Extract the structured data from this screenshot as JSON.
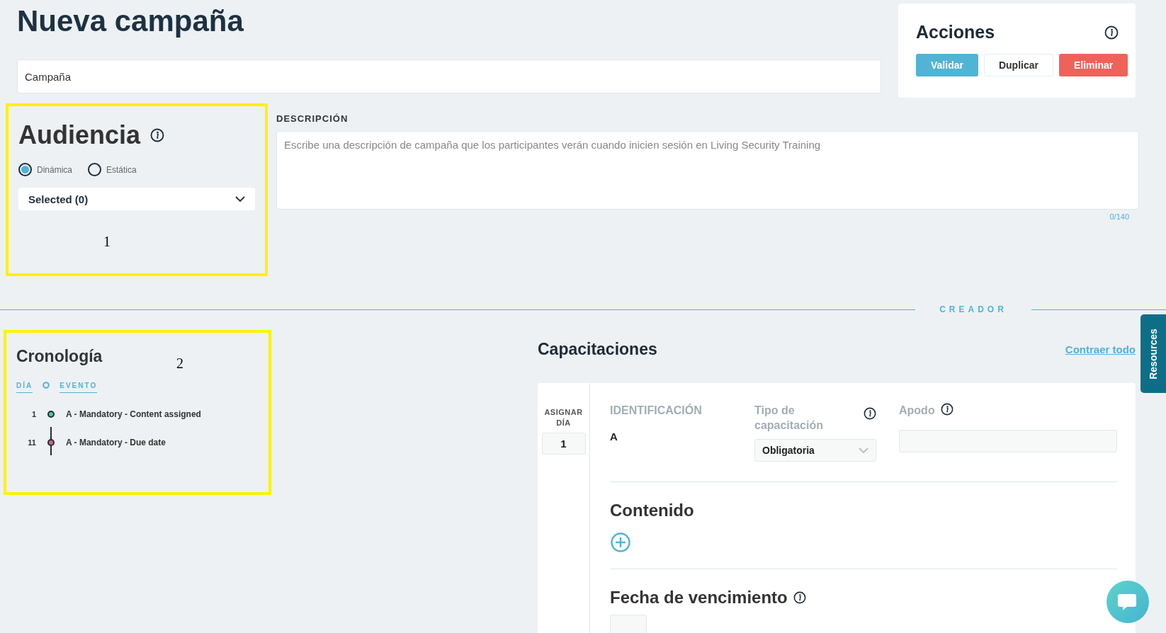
{
  "page_title": "Nueva campaña",
  "campaign_name": {
    "value": "Campaña"
  },
  "actions": {
    "title": "Acciones",
    "buttons": [
      {
        "label": "Validar",
        "kind": "primary"
      },
      {
        "label": "Duplicar",
        "kind": "secondary"
      },
      {
        "label": "Eliminar",
        "kind": "danger"
      }
    ]
  },
  "audience": {
    "title": "Audiencia",
    "options": [
      {
        "label": "Dinámica",
        "selected": true
      },
      {
        "label": "Estática",
        "selected": false
      }
    ],
    "dropdown": "Selected (0)"
  },
  "description": {
    "label": "DESCRIPCIÓN",
    "placeholder": "Escribe una descripción de campaña que los participantes verán cuando inicien sesión en Living Security Training",
    "counter": "0/140"
  },
  "divider_label": "CREADOR",
  "timeline": {
    "title": "Cronología",
    "columns": [
      "DÍA",
      "EVENTO"
    ],
    "events": [
      {
        "day": "1",
        "label": "A - Mandatory - Content assigned",
        "color": "#4fc3a1"
      },
      {
        "day": "11",
        "label": "A - Mandatory - Due date",
        "color": "#e0607a"
      }
    ]
  },
  "trainings": {
    "title": "Capacitaciones",
    "collapse_link": "Contraer todo",
    "items": [
      {
        "assign_day_label": "ASIGNAR DÍA",
        "day": "1",
        "id_label": "IDENTIFICACIÓN",
        "id": "A",
        "type_label": "Tipo de capacitación",
        "type": "Obligatoria",
        "nickname_label": "Apodo",
        "content_title": "Contenido",
        "due_title": "Fecha de vencimiento"
      }
    ]
  },
  "resources_tab": "Resources",
  "annotations": [
    {
      "label": "1"
    },
    {
      "label": "2"
    }
  ]
}
